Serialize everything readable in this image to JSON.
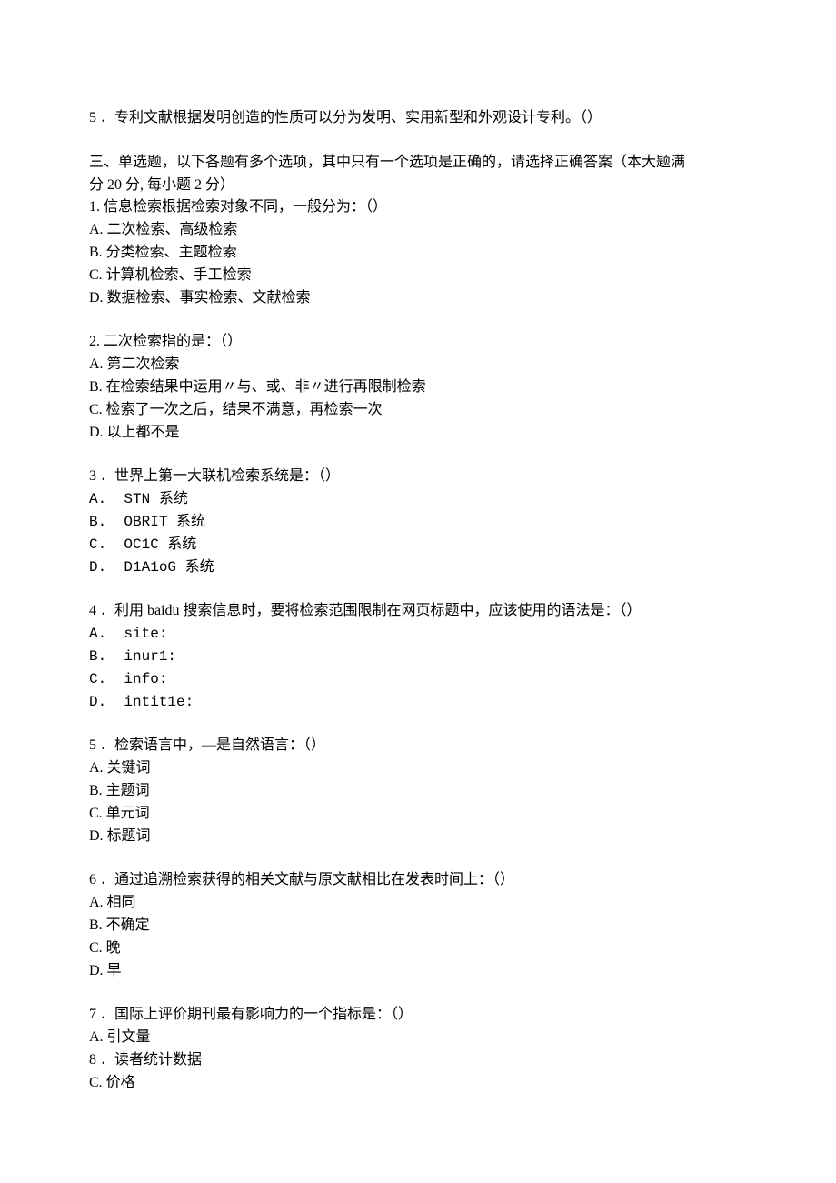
{
  "top_line": "5 ．专利文献根据发明创造的性质可以分为发明、实用新型和外观设计专利。（）",
  "section_header_line1": "三、单选题，以下各题有多个选项，其中只有一个选项是正确的，请选择正确答案（本大题满",
  "section_header_line2": "分 20 分, 每小题 2 分）",
  "q1": {
    "stem": "1. 信息检索根据检索对象不同，一般分为：（）",
    "a": "A. 二次检索、高级检索",
    "b": "B. 分类检索、主题检索",
    "c": "C. 计算机检索、手工检索",
    "d": "D. 数据检索、事实检索、文献检索"
  },
  "q2": {
    "stem": "2. 二次检索指的是：（）",
    "a": "A. 第二次检索",
    "b": "B. 在检索结果中运用〃与、或、非〃进行再限制检索",
    "c": "C. 检索了一次之后，结果不满意，再检索一次",
    "d": "D. 以上都不是"
  },
  "q3": {
    "stem": "3 ．世界上第一大联机检索系统是：（）",
    "a": "A.  STN 系统",
    "b": "B.  OBRIT 系统",
    "c": "C.  OC1C 系统",
    "d": "D.  D1A1oG 系统"
  },
  "q4": {
    "stem": "4 ．利用 baidu 搜索信息时，要将检索范围限制在网页标题中，应该使用的语法是：（）",
    "a": "A.  site:",
    "b": "B.  inur1:",
    "c": "C.  info:",
    "d": "D.  intit1e:"
  },
  "q5": {
    "stem": "5 ．检索语言中，—是自然语言：（）",
    "a": "A. 关键词",
    "b": "B. 主题词",
    "c": "C. 单元词",
    "d": "D. 标题词"
  },
  "q6": {
    "stem": "6 ．通过追溯检索获得的相关文献与原文献相比在发表时间上：（）",
    "a": "A. 相同",
    "b": "B. 不确定",
    "c": "C. 晚",
    "d": "D. 早"
  },
  "q7": {
    "stem": "7 ．国际上评价期刊最有影响力的一个指标是：（）",
    "a": "A. 引文量",
    "b": "8 ．读者统计数据",
    "c": "C. 价格"
  }
}
